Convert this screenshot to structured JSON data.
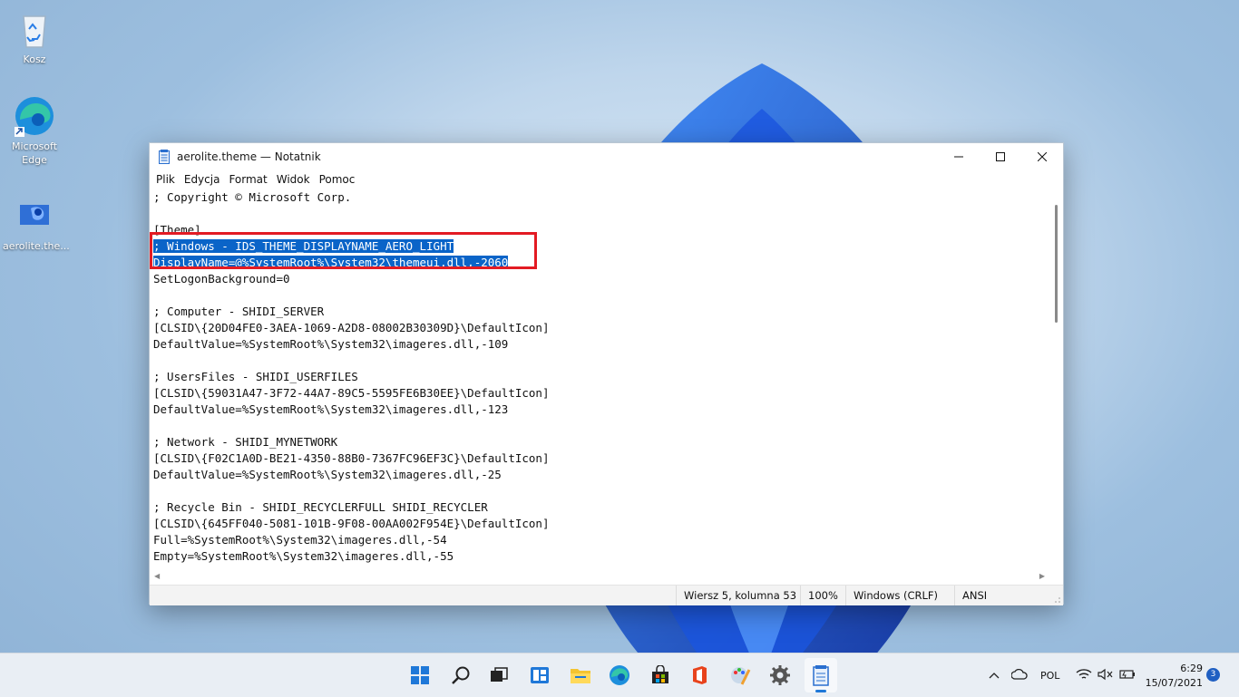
{
  "desktop": {
    "icons": [
      {
        "label": "Kosz"
      },
      {
        "label": "Microsoft Edge"
      },
      {
        "label": "aerolite.the..."
      }
    ]
  },
  "window": {
    "title": "aerolite.theme — Notatnik",
    "menu": [
      "Plik",
      "Edycja",
      "Format",
      "Widok",
      "Pomoc"
    ],
    "lines": [
      "; Copyright © Microsoft Corp.",
      "",
      "[Theme]",
      "; Windows - IDS_THEME_DISPLAYNAME_AERO_LIGHT",
      "DisplayName=@%SystemRoot%\\System32\\themeui.dll,-2060",
      "SetLogonBackground=0",
      "",
      "; Computer - SHIDI_SERVER",
      "[CLSID\\{20D04FE0-3AEA-1069-A2D8-08002B30309D}\\DefaultIcon]",
      "DefaultValue=%SystemRoot%\\System32\\imageres.dll,-109",
      "",
      "; UsersFiles - SHIDI_USERFILES",
      "[CLSID\\{59031A47-3F72-44A7-89C5-5595FE6B30EE}\\DefaultIcon]",
      "DefaultValue=%SystemRoot%\\System32\\imageres.dll,-123",
      "",
      "; Network - SHIDI_MYNETWORK",
      "[CLSID\\{F02C1A0D-BE21-4350-88B0-7367FC96EF3C}\\DefaultIcon]",
      "DefaultValue=%SystemRoot%\\System32\\imageres.dll,-25",
      "",
      "; Recycle Bin - SHIDI_RECYCLERFULL SHIDI_RECYCLER",
      "[CLSID\\{645FF040-5081-101B-9F08-00AA002F954E}\\DefaultIcon]",
      "Full=%SystemRoot%\\System32\\imageres.dll,-54",
      "Empty=%SystemRoot%\\System32\\imageres.dll,-55"
    ],
    "selected_lines": [
      3,
      4
    ],
    "status": {
      "position": "Wiersz 5, kolumna 53",
      "zoom": "100%",
      "line_ending": "Windows (CRLF)",
      "encoding": "ANSI"
    }
  },
  "taskbar": {
    "apps": [
      "start-icon",
      "search-icon",
      "task-view-icon",
      "widgets-icon",
      "file-explorer-icon",
      "edge-icon",
      "store-icon",
      "office-icon",
      "paint-icon",
      "settings-icon",
      "notepad-icon"
    ],
    "tray": {
      "language": "POL",
      "time": "6:29",
      "date": "15/07/2021",
      "notifications": "3"
    }
  },
  "colors": {
    "selection": "#0a64c8",
    "highlight_box": "#e31b23",
    "accent": "#1f5fc2"
  }
}
